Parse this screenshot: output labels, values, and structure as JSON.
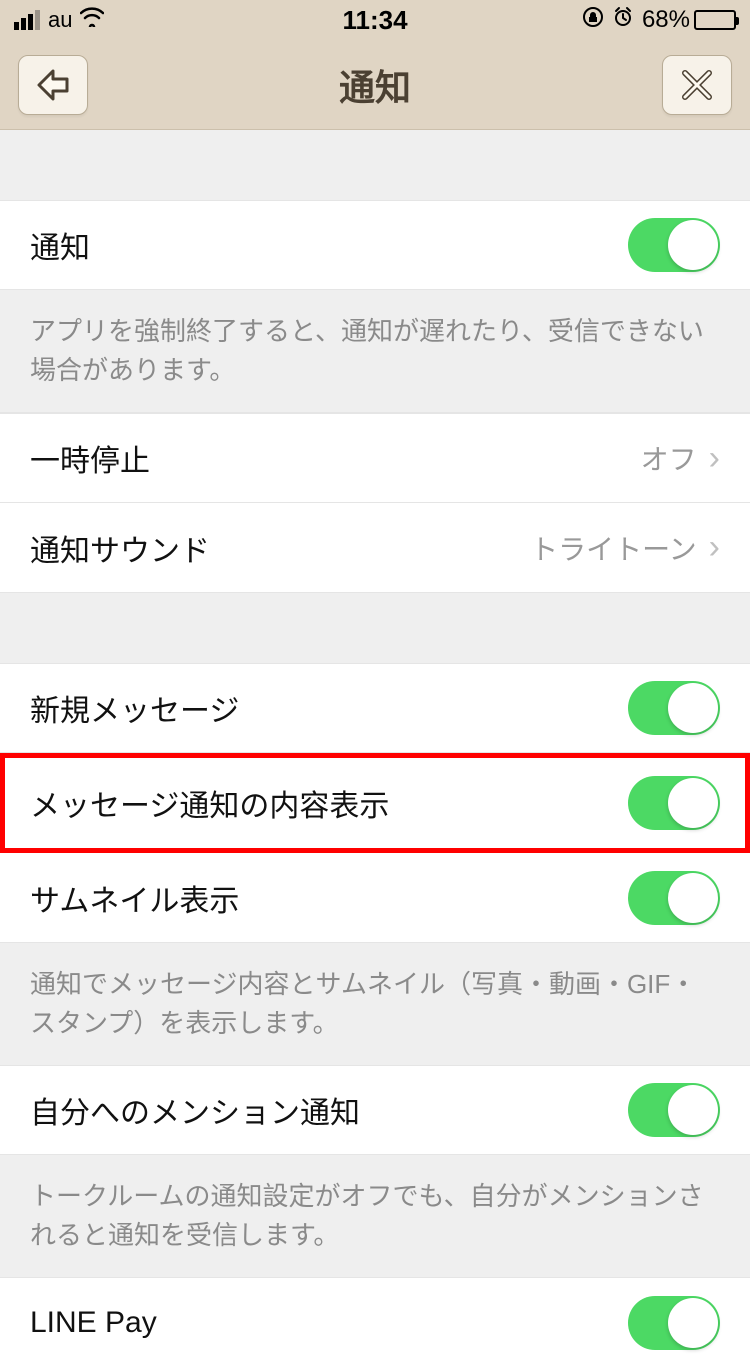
{
  "statusbar": {
    "carrier": "au",
    "time": "11:34",
    "battery_pct": "68%"
  },
  "header": {
    "title": "通知"
  },
  "rows": {
    "notify": {
      "label": "通知"
    },
    "notify_footer": "アプリを強制終了すると、通知が遅れたり、受信できない場合があります。",
    "pause": {
      "label": "一時停止",
      "value": "オフ"
    },
    "sound": {
      "label": "通知サウンド",
      "value": "トライトーン"
    },
    "new_message": {
      "label": "新規メッセージ"
    },
    "content_preview": {
      "label": "メッセージ通知の内容表示"
    },
    "thumbnail": {
      "label": "サムネイル表示"
    },
    "thumbnail_footer": "通知でメッセージ内容とサムネイル（写真・動画・GIF・スタンプ）を表示します。",
    "mention": {
      "label": "自分へのメンション通知"
    },
    "mention_footer": "トークルームの通知設定がオフでも、自分がメンションされると通知を受信します。",
    "linepay": {
      "label": "LINE Pay"
    }
  }
}
